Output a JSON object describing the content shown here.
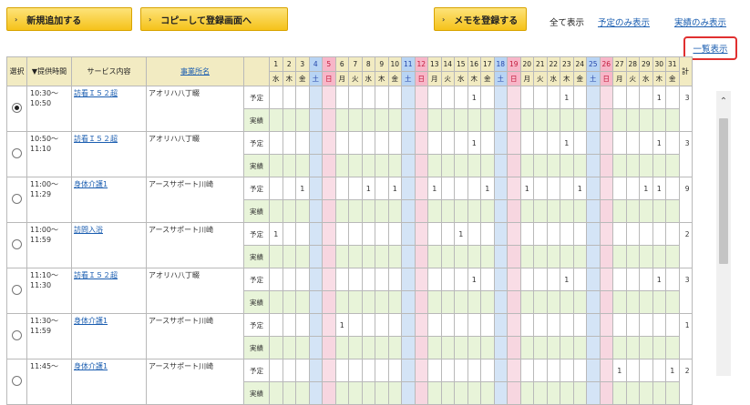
{
  "toolbar": {
    "add_label": "新規追加する",
    "copy_label": "コピーして登録画面へ",
    "memo_label": "メモを登録する",
    "show_all": "全て表示",
    "show_plan_only": "予定のみ表示",
    "show_actual_only": "実績のみ表示",
    "list_view": "一覧表示"
  },
  "headers": {
    "select": "選択",
    "time": "▼提供時間",
    "service": "サービス内容",
    "office": "事業所名",
    "total": "計"
  },
  "days": [
    {
      "n": "1",
      "w": "水"
    },
    {
      "n": "2",
      "w": "木"
    },
    {
      "n": "3",
      "w": "金"
    },
    {
      "n": "4",
      "w": "土"
    },
    {
      "n": "5",
      "w": "日"
    },
    {
      "n": "6",
      "w": "月"
    },
    {
      "n": "7",
      "w": "火"
    },
    {
      "n": "8",
      "w": "水"
    },
    {
      "n": "9",
      "w": "木"
    },
    {
      "n": "10",
      "w": "金"
    },
    {
      "n": "11",
      "w": "土"
    },
    {
      "n": "12",
      "w": "日"
    },
    {
      "n": "13",
      "w": "月"
    },
    {
      "n": "14",
      "w": "火"
    },
    {
      "n": "15",
      "w": "水"
    },
    {
      "n": "16",
      "w": "木"
    },
    {
      "n": "17",
      "w": "金"
    },
    {
      "n": "18",
      "w": "土"
    },
    {
      "n": "19",
      "w": "日"
    },
    {
      "n": "20",
      "w": "月"
    },
    {
      "n": "21",
      "w": "火"
    },
    {
      "n": "22",
      "w": "水"
    },
    {
      "n": "23",
      "w": "木"
    },
    {
      "n": "24",
      "w": "金"
    },
    {
      "n": "25",
      "w": "土"
    },
    {
      "n": "26",
      "w": "日"
    },
    {
      "n": "27",
      "w": "月"
    },
    {
      "n": "28",
      "w": "火"
    },
    {
      "n": "29",
      "w": "水"
    },
    {
      "n": "30",
      "w": "木"
    },
    {
      "n": "31",
      "w": "金"
    }
  ],
  "kinds": {
    "plan": "予定",
    "actual": "実績"
  },
  "rows": [
    {
      "time": "10:30〜\n10:50",
      "service": "訪看Ｉ５２超",
      "office": "アオリハ八丁畷",
      "selected": true,
      "plan": {
        "16": "1",
        "23": "1",
        "30": "1"
      },
      "total": "3"
    },
    {
      "time": "10:50〜\n11:10",
      "service": "訪看Ｉ５２超",
      "office": "アオリハ八丁畷",
      "selected": false,
      "plan": {
        "16": "1",
        "23": "1",
        "30": "1"
      },
      "total": "3"
    },
    {
      "time": "11:00〜\n11:29",
      "service": "身体介護1",
      "office": "アースサポート川崎",
      "selected": false,
      "plan": {
        "3": "1",
        "8": "1",
        "10": "1",
        "13": "1",
        "17": "1",
        "20": "1",
        "24": "1",
        "29": "1",
        "30": "1"
      },
      "total": "9"
    },
    {
      "time": "11:00〜\n11:59",
      "service": "訪問入浴",
      "office": "アースサポート川崎",
      "selected": false,
      "plan": {
        "1": "1",
        "15": "1"
      },
      "total": "2"
    },
    {
      "time": "11:10〜\n11:30",
      "service": "訪看Ｉ５２超",
      "office": "アオリハ八丁畷",
      "selected": false,
      "plan": {
        "16": "1",
        "23": "1",
        "30": "1"
      },
      "total": "3"
    },
    {
      "time": "11:30〜\n11:59",
      "service": "身体介護1",
      "office": "アースサポート川崎",
      "selected": false,
      "plan": {
        "6": "1"
      },
      "total": "1"
    },
    {
      "time": "11:45〜",
      "service": "身体介護1",
      "office": "アースサポート川崎",
      "selected": false,
      "plan": {
        "27": "1",
        "31": "1"
      },
      "total": "2"
    }
  ]
}
